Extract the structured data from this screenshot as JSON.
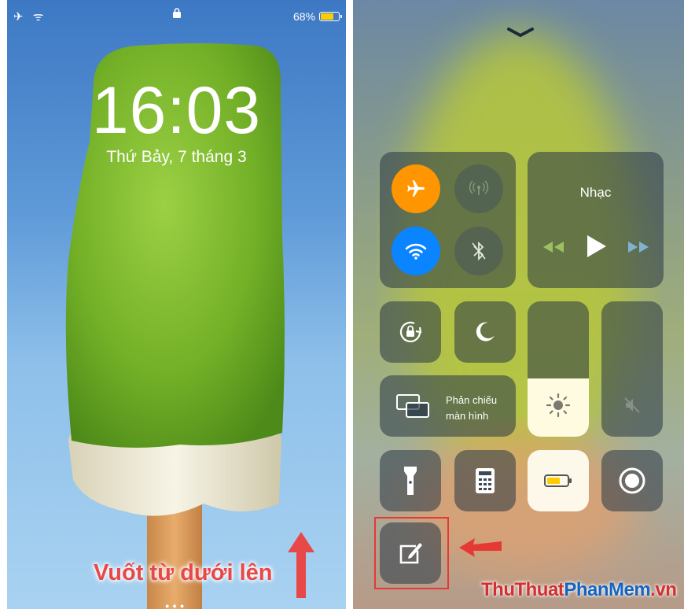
{
  "lockscreen": {
    "status": {
      "left_icons": "✈ ᯤ",
      "battery_percent": "68%",
      "battery_level": 0.68
    },
    "time": "16:03",
    "date": "Thứ Bảy, 7 tháng 3",
    "instruction": "Vuốt từ dưới lên"
  },
  "control_center": {
    "music_title": "Nhạc",
    "screen_mirroring_label_line1": "Phản chiếu",
    "screen_mirroring_label_line2": "màn hình",
    "brightness_level": 0.43,
    "volume_level": 0,
    "accent_orange": "#ff9500",
    "accent_blue": "#0a84ff"
  },
  "watermark": {
    "part1": "ThuThuat",
    "part2": "PhanMem",
    "part3": ".vn"
  }
}
